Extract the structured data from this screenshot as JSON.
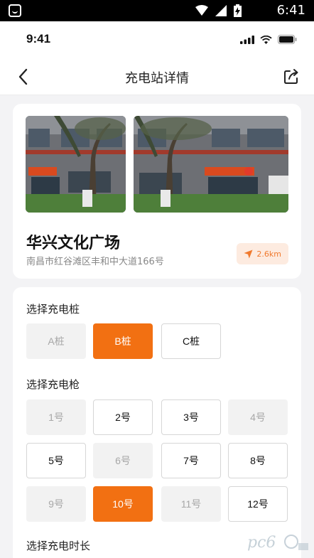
{
  "system_bar": {
    "time": "6:41"
  },
  "ios_status": {
    "time": "9:41"
  },
  "nav": {
    "title": "充电站详情"
  },
  "station": {
    "name": "华兴文化广场",
    "address": "南昌市红谷滩区丰和中大道166号",
    "distance": "2.6km"
  },
  "pile_section": {
    "title": "选择充电桩",
    "options": [
      {
        "label": "A桩",
        "state": "disabled"
      },
      {
        "label": "B桩",
        "state": "selected"
      },
      {
        "label": "C桩",
        "state": "normal"
      }
    ]
  },
  "gun_section": {
    "title": "选择充电枪",
    "options": [
      {
        "label": "1号",
        "state": "disabled"
      },
      {
        "label": "2号",
        "state": "normal"
      },
      {
        "label": "3号",
        "state": "normal"
      },
      {
        "label": "4号",
        "state": "disabled"
      },
      {
        "label": "5号",
        "state": "normal"
      },
      {
        "label": "6号",
        "state": "disabled"
      },
      {
        "label": "7号",
        "state": "normal"
      },
      {
        "label": "8号",
        "state": "normal"
      },
      {
        "label": "9号",
        "state": "disabled"
      },
      {
        "label": "10号",
        "state": "selected"
      },
      {
        "label": "11号",
        "state": "disabled"
      },
      {
        "label": "12号",
        "state": "normal"
      }
    ]
  },
  "duration_section": {
    "title": "选择充电时长"
  },
  "colors": {
    "accent": "#f27012",
    "badge_bg": "#fdebe0",
    "badge_text": "#f07a2e"
  }
}
